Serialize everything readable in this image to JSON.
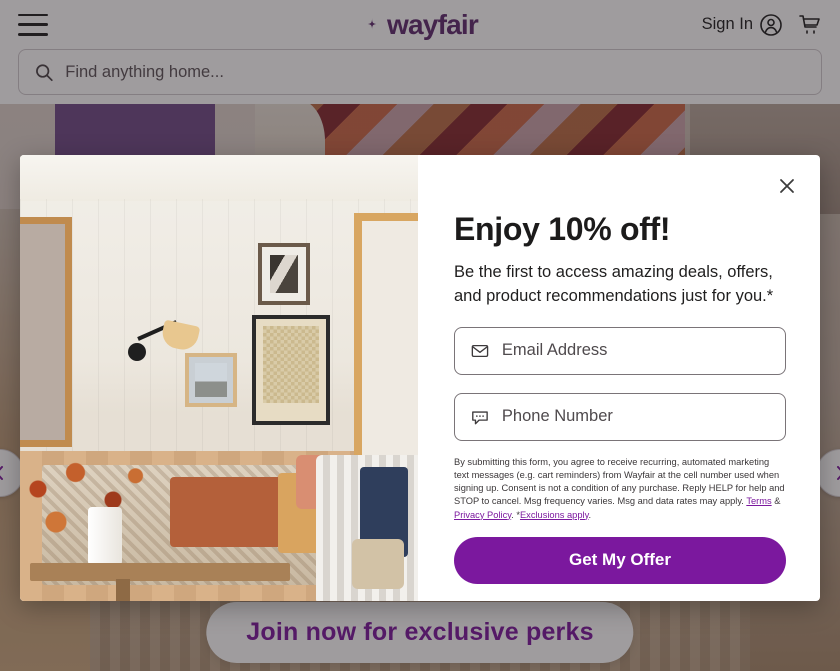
{
  "header": {
    "menu_icon": "hamburger-menu-icon",
    "brand": "wayfair",
    "sign_in_label": "Sign In",
    "account_icon": "account-person-icon",
    "cart_icon": "shopping-cart-icon",
    "search": {
      "icon": "search-icon",
      "placeholder": "Find anything home...",
      "value": ""
    }
  },
  "hero": {
    "cta_label": "Join now for exclusive perks",
    "prev_icon": "chevron-left-icon",
    "next_icon": "chevron-right-icon"
  },
  "modal": {
    "photo_alt": "living-room-interior-photo",
    "close_icon": "close-x-icon",
    "title": "Enjoy 10% off!",
    "subtitle": "Be the first to access amazing deals, offers, and product recommendations just for you.*",
    "email_field": {
      "icon": "envelope-icon",
      "placeholder": "Email Address",
      "value": ""
    },
    "phone_field": {
      "icon": "chat-bubble-icon",
      "placeholder": "Phone Number",
      "value": ""
    },
    "fineprint": {
      "text_before_terms": "By submitting this form, you agree to receive recurring, automated marketing text messages (e.g. cart reminders) from Wayfair at the cell number used when signing up. Consent is not a condition of any purchase. Reply HELP for help and STOP to cancel. Msg frequency varies. Msg and data rates may apply. ",
      "terms_link": "Terms",
      "amp": " & ",
      "privacy_link": "Privacy Policy",
      "mid": ". *",
      "exclusions_link": "Exclusions apply",
      "end": "."
    },
    "submit_label": "Get My Offer"
  },
  "colors": {
    "brand_purple": "#7B189E",
    "logo_purple": "#5D2A6E",
    "overlay": "rgba(36,30,34,.44)",
    "text_dark": "#1c1b1b"
  }
}
